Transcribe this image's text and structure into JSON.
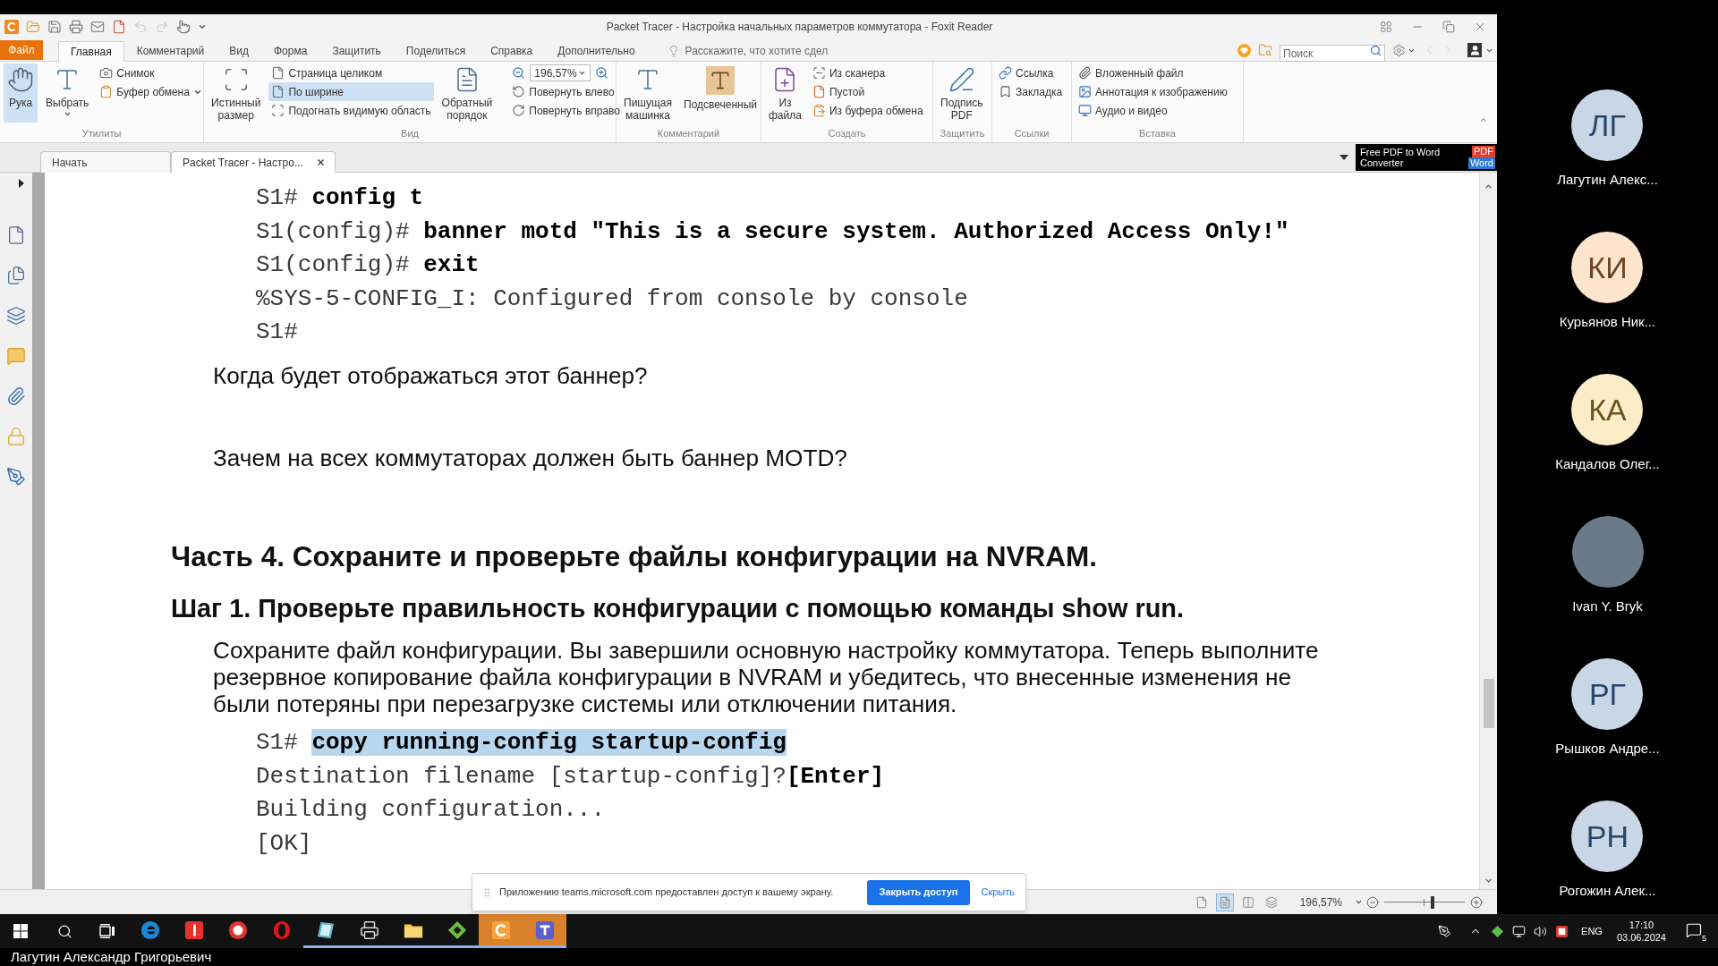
{
  "window": {
    "title": "Packet Tracer - Настройка начальных параметров коммутатора - Foxit Reader"
  },
  "quick_access": {
    "undo": {
      "disabled": true
    },
    "redo": {
      "disabled": true
    }
  },
  "menu": {
    "file": "Файл",
    "tabs": [
      {
        "label": "Главная",
        "selected": true
      },
      {
        "label": "Комментарий",
        "selected": false
      },
      {
        "label": "Вид",
        "selected": false
      },
      {
        "label": "Форма",
        "selected": false
      },
      {
        "label": "Защитить",
        "selected": false
      },
      {
        "label": "Поделиться",
        "selected": false
      },
      {
        "label": "Справка",
        "selected": false
      },
      {
        "label": "Дополнительно",
        "selected": false
      }
    ],
    "tell_me": {
      "placeholder": "Расскажите, что хотите сдел"
    },
    "search": {
      "placeholder": "Поиск"
    },
    "back": {
      "disabled": true
    },
    "forward": {
      "disabled": true
    }
  },
  "ribbon": {
    "groups": [
      {
        "label": "Утилиты",
        "controls": [
          {
            "kind": "large",
            "label": "Рука",
            "selected": true
          },
          {
            "kind": "large",
            "label": "Выбрать",
            "selected": false,
            "dropdown": true
          },
          {
            "kind": "stack",
            "items": [
              {
                "label": "Снимок",
                "selected": false
              },
              {
                "label": "Буфер обмена",
                "selected": false,
                "dropdown": true
              }
            ]
          }
        ]
      },
      {
        "label": "Вид",
        "controls": [
          {
            "kind": "large",
            "label": "Истинный размер",
            "selected": false
          },
          {
            "kind": "stack",
            "items": [
              {
                "label": "Страница целиком",
                "selected": false
              },
              {
                "label": "По ширине",
                "selected": true
              },
              {
                "label": "Подогнать видимую область",
                "selected": false
              }
            ]
          },
          {
            "kind": "large",
            "label": "Обратный порядок",
            "selected": false
          },
          {
            "kind": "zoom",
            "value": "196,57%",
            "items": [
              {
                "label": "Повернуть влево",
                "selected": false
              },
              {
                "label": "Повернуть вправо",
                "selected": false
              }
            ]
          }
        ]
      },
      {
        "label": "Комментарий",
        "controls": [
          {
            "kind": "large",
            "label": "Пишущая машинка",
            "selected": false
          },
          {
            "kind": "large",
            "label": "Подсвеченный",
            "selected": false
          }
        ]
      },
      {
        "label": "Создать",
        "controls": [
          {
            "kind": "large",
            "label": "Из файла",
            "selected": false
          },
          {
            "kind": "stack",
            "items": [
              {
                "label": "Из сканера",
                "selected": false
              },
              {
                "label": "Пустой",
                "selected": false
              },
              {
                "label": "Из буфера обмена",
                "selected": false
              }
            ]
          }
        ]
      },
      {
        "label": "Защитить",
        "controls": [
          {
            "kind": "large",
            "label": "Подпись PDF",
            "selected": false
          }
        ]
      },
      {
        "label": "Ссылки",
        "controls": [
          {
            "kind": "stack",
            "items": [
              {
                "label": "Ссылка",
                "selected": false
              },
              {
                "label": "Закладка",
                "selected": false
              }
            ]
          }
        ]
      },
      {
        "label": "Вставка",
        "controls": [
          {
            "kind": "stack",
            "items": [
              {
                "label": "Вложенный файл",
                "selected": false
              },
              {
                "label": "Аннотация к изображению",
                "selected": false
              },
              {
                "label": "Аудио и видео",
                "selected": false
              }
            ]
          }
        ]
      }
    ]
  },
  "doc_tabs": [
    {
      "label": "Начать",
      "selected": false
    },
    {
      "label": "Packet Tracer - Настро...",
      "selected": true,
      "closable": true
    }
  ],
  "ad": {
    "text": "Free PDF to Word Converter",
    "from": "PDF",
    "to": "Word"
  },
  "document": {
    "blocks": [
      {
        "kind": "code",
        "lines": [
          {
            "kind": "command",
            "prompt": "S1#",
            "command": "config t",
            "selected": false
          },
          {
            "kind": "command",
            "prompt": "S1(config)#",
            "command": "banner motd \"This is a secure system. Authorized Access Only!\"",
            "selected": false
          },
          {
            "kind": "command",
            "prompt": "S1(config)#",
            "command": "exit",
            "selected": false
          },
          {
            "kind": "output",
            "text": "%SYS-5-CONFIG_I: Configured from console by console"
          },
          {
            "kind": "output",
            "text": "S1#"
          }
        ]
      },
      {
        "kind": "question",
        "text": "Когда будет отображаться этот баннер?"
      },
      {
        "kind": "question",
        "text": "Зачем на всех коммутаторах должен быть баннер MOTD?"
      },
      {
        "kind": "heading1",
        "text": "Часть 4. Сохраните и проверьте файлы конфигурации на NVRAM."
      },
      {
        "kind": "heading2",
        "text": "Шаг 1. Проверьте правильность конфигурации с помощью команды show run."
      },
      {
        "kind": "paragraph",
        "text": "Сохраните файл конфигурации. Вы завершили основную настройку коммутатора. Теперь выполните резервное копирование файла конфигурации в NVRAM и убедитесь, что внесенные изменения не были потеряны при перезагрузке системы или отключении питания."
      },
      {
        "kind": "code",
        "lines": [
          {
            "kind": "command",
            "prompt": "S1#",
            "command": "copy running-config startup-config",
            "selected": true
          },
          {
            "kind": "output",
            "text": "Destination filename [startup-config]?**[Enter]**"
          },
          {
            "kind": "output",
            "text": "Building configuration..."
          },
          {
            "kind": "output",
            "text": "[OK]"
          }
        ]
      }
    ]
  },
  "status_bar": {
    "view_modes": [
      {
        "selected": false
      },
      {
        "selected": true
      },
      {
        "selected": false
      },
      {
        "selected": false
      }
    ],
    "zoom": "196,57%",
    "zoom_slider": {
      "level": 0.6
    }
  },
  "notification": {
    "message": "Приложению teams.microsoft.com предоставлен доступ к вашему экрану.",
    "primary_button": "Закрыть доступ",
    "link": "Скрыть"
  },
  "participants": [
    {
      "kind": "initials",
      "initials": "ЛГ",
      "name": "Лагутин Алекс...",
      "color": "#c8d6e5"
    },
    {
      "kind": "initials",
      "initials": "КИ",
      "name": "Курьянов Ник...",
      "color": "#fde4cd"
    },
    {
      "kind": "initials",
      "initials": "КА",
      "name": "Кандалов Олег...",
      "color": "#fdecc8"
    },
    {
      "kind": "photo",
      "name": "Ivan Y. Bryk"
    },
    {
      "kind": "initials",
      "initials": "РГ",
      "name": "Рышков Андре...",
      "color": "#c8d6e5"
    },
    {
      "kind": "initials",
      "initials": "РН",
      "name": "Рогожин Алек...",
      "color": "#c8d6e5"
    }
  ],
  "taskbar": {
    "apps": [
      {
        "running": false,
        "highlighted": false
      },
      {
        "running": false,
        "highlighted": false
      },
      {
        "running": false,
        "highlighted": false
      },
      {
        "running": false,
        "highlighted": false
      },
      {
        "running": true,
        "highlighted": false
      },
      {
        "running": true,
        "highlighted": false
      },
      {
        "running": true,
        "highlighted": false
      },
      {
        "running": true,
        "highlighted": false
      },
      {
        "running": true,
        "highlighted": true
      },
      {
        "running": true,
        "highlighted": true
      }
    ],
    "tray": {
      "language": "ENG",
      "time": "17:10",
      "date": "03.06.2024",
      "notifications": "5"
    }
  },
  "presenter": {
    "name": "Лагутин Александр Григорьевич"
  }
}
